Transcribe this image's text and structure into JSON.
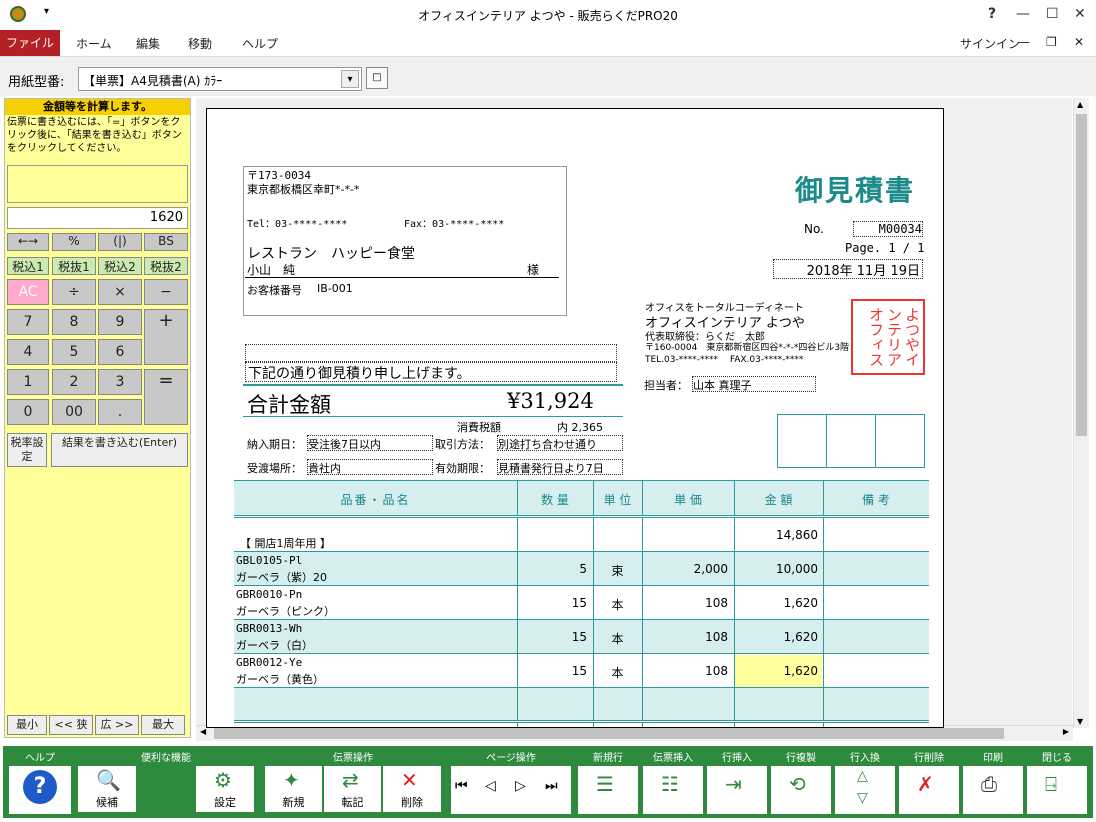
{
  "window": {
    "title": "オフィスインテリア よつや - 販売らくだPRO20",
    "help": "?",
    "signin": "サインイン"
  },
  "menu": {
    "file": "ファイル",
    "home": "ホーム",
    "edit": "編集",
    "move": "移動",
    "help": "ヘルプ"
  },
  "form_select": {
    "label": "用紙型番:",
    "value": "【単票】A4見積書(A) ｶﾗｰ"
  },
  "calc": {
    "header": "金額等を計算します。",
    "instructions": "伝票に書き込むには、「=」ボタンをクリック後に、「結果を書き込む」ボタンをクリックしてください。",
    "display": "1620",
    "keys_row1": [
      "←→",
      "%",
      "(|)",
      "BS"
    ],
    "keys_row2": [
      "税込1",
      "税抜1",
      "税込2",
      "税抜2"
    ],
    "keys_row3": [
      "AC",
      "÷",
      "×",
      "−"
    ],
    "digits": [
      "7",
      "8",
      "9",
      "4",
      "5",
      "6",
      "1",
      "2",
      "3",
      "0",
      "00",
      "."
    ],
    "plus": "+",
    "equals": "=",
    "tax_setting": "税率設定",
    "write_result": "結果を書き込む(Enter)",
    "zoom": [
      "最小",
      "<< 狭",
      "広 >>",
      "最大"
    ]
  },
  "doc": {
    "title": "御見積書",
    "postal": "〒173-0034",
    "address": "東京都板橋区幸町*-*-*",
    "tel": "Tel：03-****-****",
    "fax": "Fax：03-****-****",
    "customer": "レストラン　ハッピー食堂",
    "contact": "小山　純",
    "sama": "様",
    "customer_no_label": "お客様番号",
    "customer_no": "IB-001",
    "no_label": "No.",
    "no": "M00034",
    "page": "Page. 1 / 1",
    "date": "2018年 11月 19日",
    "company_tagline": "オフィスをトータルコーディネート",
    "company": "オフィスインテリア よつや",
    "rep": "代表取締役：らくだ　太郎",
    "company_addr": "〒160-0004　東京都新宿区四谷*-*-*四谷ビル3階",
    "company_tel": "TEL.03-****-****　 FAX.03-****-****",
    "stamp": "よつやインテリアオフィス",
    "greeting": "下記の通り御見積り申し上げます。",
    "total_label": "合計金額",
    "total": "¥31,924",
    "tax_label": "消費税額",
    "tax": "内 2,365",
    "staff_label": "担当者：",
    "staff": "山本 真理子",
    "delivery_label": "納入期日：",
    "delivery": "受注後7日以内",
    "terms_label": "取引方法：",
    "terms": "別途打ち合わせ通り",
    "place_label": "受渡場所：",
    "place": "貴社内",
    "valid_label": "有効期限：",
    "valid": "見積書発行日より7日",
    "cols": [
      "品番・品名",
      "数 量",
      "単 位",
      "単 価",
      "金 額",
      "備 考"
    ],
    "rows": [
      {
        "code": "",
        "name": "【 開店1周年用 】",
        "qty": "",
        "unit": "",
        "price": "",
        "amount": "14,860"
      },
      {
        "code": "GBL0105-Pl",
        "name": "ガーベラ（紫）20",
        "qty": "5",
        "unit": "束",
        "price": "2,000",
        "amount": "10,000"
      },
      {
        "code": "GBR0010-Pn",
        "name": "ガーベラ（ピンク）",
        "qty": "15",
        "unit": "本",
        "price": "108",
        "amount": "1,620"
      },
      {
        "code": "GBR0013-Wh",
        "name": "ガーベラ（白）",
        "qty": "15",
        "unit": "本",
        "price": "108",
        "amount": "1,620"
      },
      {
        "code": "GBR0012-Ye",
        "name": "ガーベラ（黄色）",
        "qty": "15",
        "unit": "本",
        "price": "108",
        "amount": "1,620"
      }
    ]
  },
  "toolbar": {
    "help": "ヘルプ",
    "useful": "便利な機能",
    "candidate": "候補",
    "settings": "設定",
    "slip_ops": "伝票操作",
    "new": "新規",
    "transfer": "転記",
    "delete": "削除",
    "page_ops": "ページ操作",
    "new_line": "新規行",
    "insert_slip": "伝票挿入",
    "insert_line": "行挿入",
    "copy_line": "行複製",
    "swap_line": "行入換",
    "delete_line": "行削除",
    "print": "印刷",
    "close": "閉じる"
  },
  "colors": {
    "accent": "#b32127",
    "teal": "#1a8a8a",
    "toolbar": "#2e8b3e",
    "calc_bg": "#ffff99"
  }
}
